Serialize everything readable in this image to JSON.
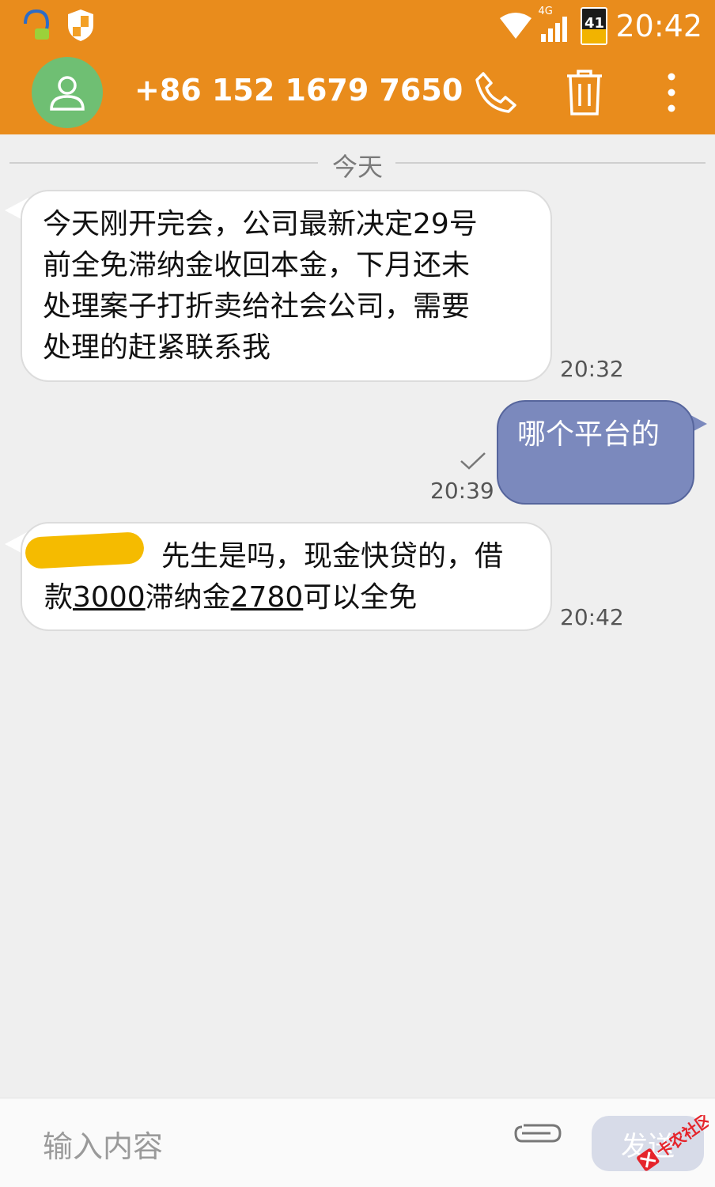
{
  "status": {
    "time": "20:42",
    "network": "4G",
    "battery": "41"
  },
  "header": {
    "contact": "+86 152 1679 7650",
    "icons": [
      "person-icon",
      "phone-icon",
      "trash-icon",
      "more-vert-icon"
    ]
  },
  "divider": {
    "label": "今天"
  },
  "messages": [
    {
      "direction": "incoming",
      "lines": [
        "今天刚开完会，公司最新决定29号",
        "前全免滞纳金收回本金，下月还未",
        "处理案子打折卖给社会公司，需要",
        "处理的赶紧联系我"
      ],
      "time": "20:32"
    },
    {
      "direction": "outgoing",
      "text": "哪个平台的",
      "time": "20:39",
      "status": "sent"
    },
    {
      "direction": "incoming",
      "line1": "先生是吗，现金快贷的，借",
      "line2_parts": [
        "款",
        "3000",
        "滞纳金",
        "2780",
        "可以全免"
      ],
      "time": "20:42"
    }
  ],
  "input": {
    "placeholder": "输入内容",
    "send_label": "发送"
  },
  "watermark": {
    "text": "卡农社区"
  },
  "colors": {
    "appbar": "#e98c1c",
    "avatar": "#6fbf73",
    "outgoing_bubble": "#7b89bd"
  }
}
